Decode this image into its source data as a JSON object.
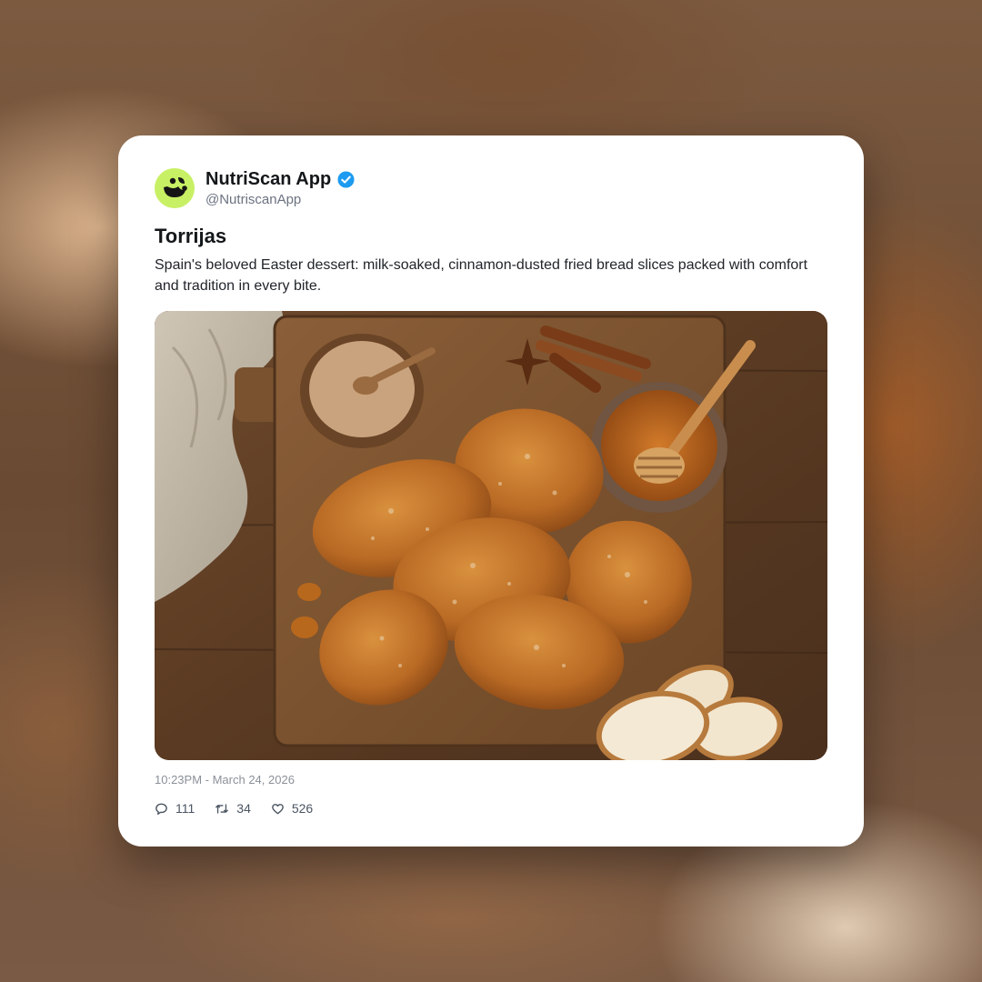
{
  "post": {
    "author": {
      "name": "NutriScan App",
      "handle": "@NutriscanApp",
      "verified": true,
      "avatar_icon": "nutriscan-logo-icon",
      "avatar_color": "#c8f064"
    },
    "title": "Torrijas",
    "description": "Spain's beloved Easter dessert: milk-soaked, cinnamon-dusted fried bread slices packed with comfort and tradition in every bite.",
    "image_icon": "torrijas-photo",
    "timestamp": "10:23PM - March 24, 2026",
    "stats": {
      "replies": "111",
      "reposts": "34",
      "likes": "526"
    }
  },
  "colors": {
    "verified_badge": "#1d9bf0",
    "accent_green": "#c8f064"
  }
}
